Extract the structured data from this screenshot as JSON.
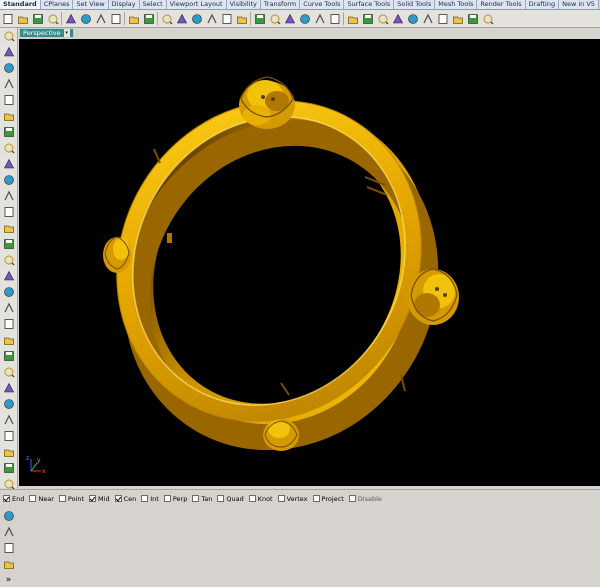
{
  "tabs": [
    "Standard",
    "CPlanes",
    "Set View",
    "Display",
    "Select",
    "Viewport Layout",
    "Visibility",
    "Transform",
    "Curve Tools",
    "Surface Tools",
    "Solid Tools",
    "Mesh Tools",
    "Render Tools",
    "Drafting",
    "New in V5"
  ],
  "active_tab": 0,
  "viewport": {
    "label": "Perspective",
    "dropdown": "▾"
  },
  "axes": {
    "x": "x",
    "y": "y",
    "z": "z"
  },
  "more_glyph": "»",
  "snaps": [
    {
      "label": "End",
      "checked": true
    },
    {
      "label": "Near",
      "checked": false
    },
    {
      "label": "Point",
      "checked": false
    },
    {
      "label": "Mid",
      "checked": true
    },
    {
      "label": "Cen",
      "checked": true
    },
    {
      "label": "Int",
      "checked": false
    },
    {
      "label": "Perp",
      "checked": false
    },
    {
      "label": "Tan",
      "checked": false
    },
    {
      "label": "Quad",
      "checked": false
    },
    {
      "label": "Knot",
      "checked": false
    },
    {
      "label": "Vertex",
      "checked": false
    },
    {
      "label": "Project",
      "checked": false
    },
    {
      "label": "Disable",
      "checked": false
    }
  ],
  "colors": {
    "gold": "#e0a400",
    "gold_dark": "#8a5a00",
    "gold_light": "#f7d000",
    "viewport_bg": "#000000",
    "viewport_tab": "#3a8a8c"
  },
  "toolbar_icons": [
    "new-icon",
    "open-icon",
    "save-icon",
    "print-icon",
    "import-icon",
    "cut-icon",
    "copy-icon",
    "paste-icon",
    "undo-icon",
    "redo-icon",
    "pan-icon",
    "rotate-view-icon",
    "zoom-icon",
    "zoom-window-icon",
    "zoom-extents-icon",
    "zoom-selected-icon",
    "grid-icon",
    "viewport-icon",
    "cplane-icon",
    "snap-icon",
    "hide-icon",
    "lock-icon",
    "layer-icon",
    "light-icon",
    "material-icon",
    "render-icon",
    "sphere-render-icon",
    "shade-icon",
    "wire-icon",
    "color-icon",
    "properties-icon",
    "help-icon"
  ],
  "left_icons": [
    "select-icon",
    "point-icon",
    "polyline-icon",
    "curve-icon",
    "circle-icon",
    "arc-icon",
    "ellipse-icon",
    "rectangle-icon",
    "polygon-icon",
    "fillet-icon",
    "offset-icon",
    "trim-icon",
    "surface-icon",
    "extrude-icon",
    "box-icon",
    "sphere-icon",
    "cylinder-icon",
    "mesh-icon",
    "boolean-icon",
    "split-icon",
    "join-icon",
    "explode-icon",
    "group-icon",
    "move-icon",
    "copy-obj-icon",
    "rotate-icon",
    "scale-icon",
    "mirror-icon",
    "array-icon",
    "text-icon",
    "dimension-icon",
    "analyze-icon",
    "render-obj-icon",
    "sphere-obj-icon",
    "more-icon"
  ]
}
